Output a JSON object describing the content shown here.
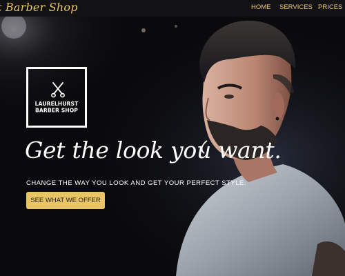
{
  "navbar": {
    "brand": "t Barber Shop",
    "links": [
      "HOME",
      "SERVICES",
      "PRICES"
    ]
  },
  "hero": {
    "logo": {
      "line1": "LAURELHURST",
      "line2": "BARBER SHOP",
      "icon": "scissors-icon"
    },
    "headline": "Get the look you want.",
    "subheadline": "CHANGE THE WAY YOU LOOK AND GET YOUR PERFECT STYLE.",
    "cta_label": "SEE WHAT WE OFFER"
  },
  "colors": {
    "accent": "#e8c464",
    "nav_background": "#121214",
    "hero_background": "#0a0a0c",
    "text": "#ffffff"
  }
}
